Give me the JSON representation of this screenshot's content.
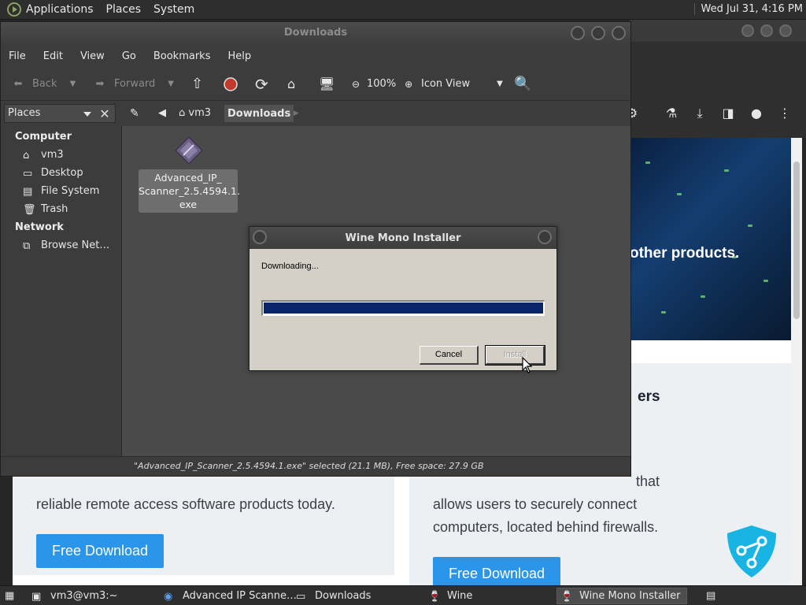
{
  "top_panel": {
    "menus": [
      "Applications",
      "Places",
      "System"
    ],
    "clock": "Wed Jul 31,  4:16 PM"
  },
  "browser": {
    "hero_text": "other products.",
    "card_title": "ers",
    "right_text": [
      "that",
      "allows users to securely connect",
      "computers, located behind firewalls."
    ],
    "left_text": "reliable remote access software products today.",
    "download_label": "Free Download"
  },
  "file_manager": {
    "title": "Downloads",
    "menus": [
      "File",
      "Edit",
      "View",
      "Go",
      "Bookmarks",
      "Help"
    ],
    "toolbar": {
      "back": "Back",
      "forward": "Forward",
      "zoom": "100%",
      "view_mode": "Icon View"
    },
    "sidebar_selector": "Places",
    "path": [
      "vm3",
      "Downloads"
    ],
    "sidebar": {
      "computer_heading": "Computer",
      "computer_items": [
        "vm3",
        "Desktop",
        "File System",
        "Trash"
      ],
      "network_heading": "Network",
      "network_items": [
        "Browse Net…"
      ]
    },
    "file": {
      "line1": "Advanced_IP_",
      "line2": "Scanner_2.5.4594.1.",
      "line3": "exe"
    },
    "status": "\"Advanced_IP_Scanner_2.5.4594.1.exe\" selected (21.1 MB), Free space: 27.9 GB"
  },
  "dialog": {
    "title": "Wine Mono Installer",
    "message": "Downloading...",
    "progress_fraction": 1.0,
    "cancel_label": "Cancel",
    "install_label": "Install"
  },
  "taskbar": {
    "items": [
      "vm3@vm3:~",
      "Advanced IP Scanne…",
      "Downloads",
      "Wine",
      "Wine Mono Installer"
    ]
  },
  "colors": {
    "accent_blue": "#2b95e9",
    "progress_fill": "#0a246a",
    "dialog_face": "#d4d0c8"
  }
}
